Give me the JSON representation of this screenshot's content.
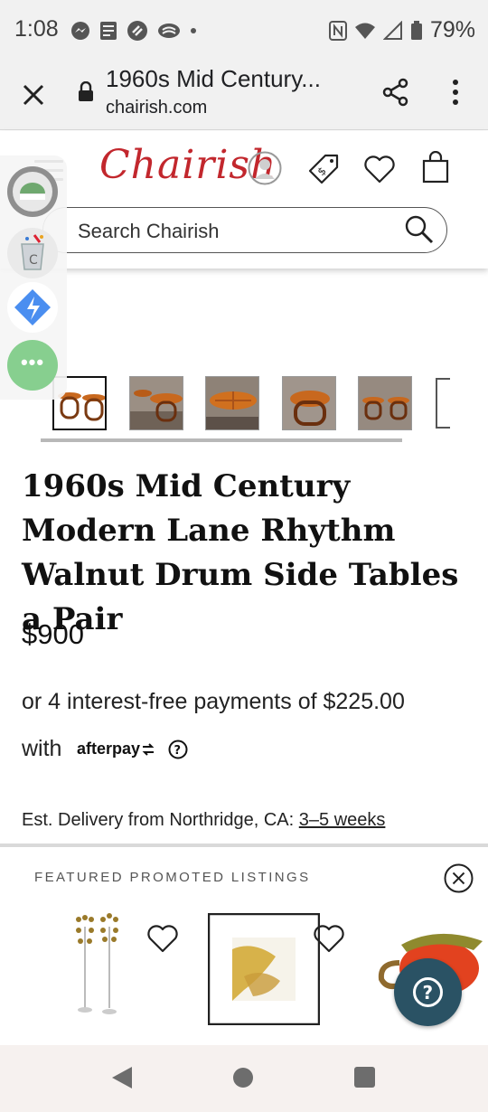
{
  "status_bar": {
    "time": "1:08",
    "battery": "79%"
  },
  "browser": {
    "page_title": "1960s Mid Century...",
    "domain": "chairish.com"
  },
  "site": {
    "logo": "Chairish",
    "search_placeholder": "Search Chairish"
  },
  "product": {
    "title": "1960s Mid Century Modern Lane Rhythm Walnut Drum Side Tables a Pair",
    "price": "$900",
    "installment_text": "or 4 interest-free payments of $225.00",
    "with_text": "with",
    "afterpay_label": "afterpay",
    "delivery_label": "Est. Delivery from Northridge, CA:",
    "delivery_time": "3–5 weeks"
  },
  "featured": {
    "heading": "FEATURED PROMOTED LISTINGS"
  },
  "colors": {
    "brand_red": "#c2272d",
    "help_fab": "#2a5264"
  }
}
